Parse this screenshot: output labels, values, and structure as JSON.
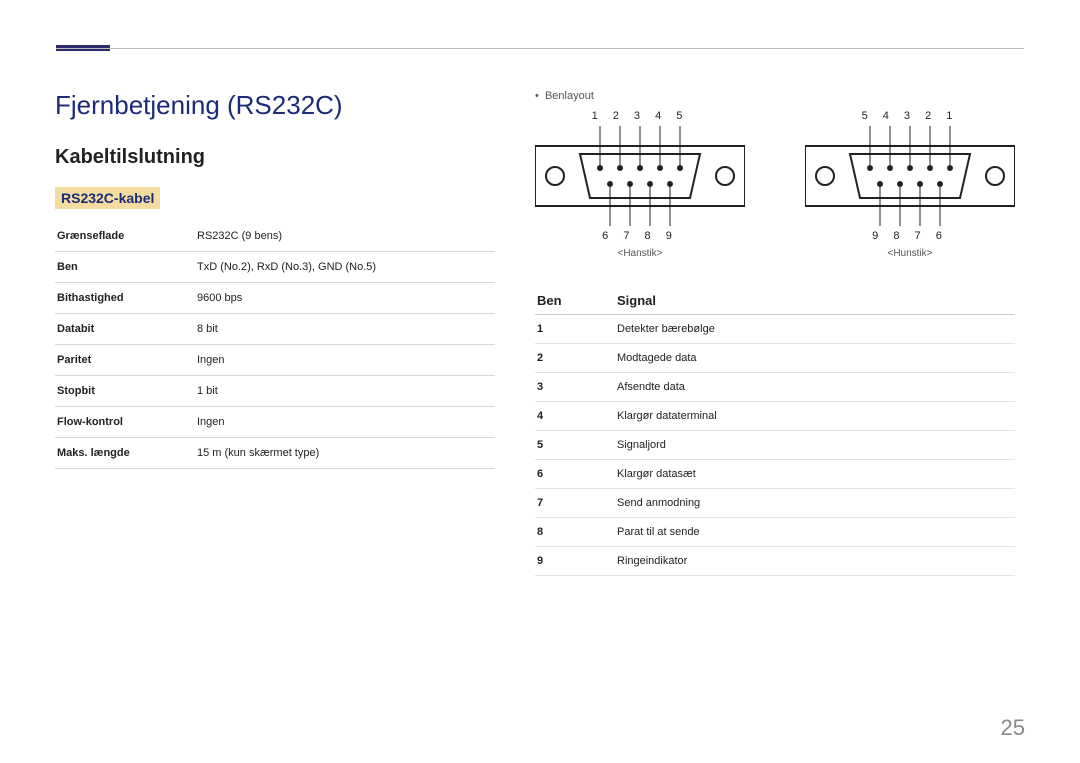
{
  "page": {
    "number": "25"
  },
  "headings": {
    "h1": "Fjernbetjening (RS232C)",
    "h2": "Kabeltilslutning",
    "h3": "RS232C-kabel"
  },
  "spec_table": [
    {
      "label": "Grænseflade",
      "value": "RS232C (9 bens)"
    },
    {
      "label": "Ben",
      "value": "TxD (No.2), RxD (No.3), GND (No.5)"
    },
    {
      "label": "Bithastighed",
      "value": "9600 bps"
    },
    {
      "label": "Databit",
      "value": "8 bit"
    },
    {
      "label": "Paritet",
      "value": "Ingen"
    },
    {
      "label": "Stopbit",
      "value": "1 bit"
    },
    {
      "label": "Flow-kontrol",
      "value": "Ingen"
    },
    {
      "label": "Maks. længde",
      "value": "15 m (kun skærmet type)"
    }
  ],
  "right": {
    "bullet": "Benlayout",
    "connectors": {
      "male": {
        "top_pins": "1 2 3 4 5",
        "bottom_pins": "6 7 8 9",
        "caption": "<Hanstik>"
      },
      "female": {
        "top_pins": "5 4 3 2 1",
        "bottom_pins": "9 8 7 6",
        "caption": "<Hunstik>"
      }
    },
    "signal_table": {
      "head_pin": "Ben",
      "head_signal": "Signal",
      "rows": [
        {
          "pin": "1",
          "signal": "Detekter bærebølge"
        },
        {
          "pin": "2",
          "signal": "Modtagede data"
        },
        {
          "pin": "3",
          "signal": "Afsendte data"
        },
        {
          "pin": "4",
          "signal": "Klargør dataterminal"
        },
        {
          "pin": "5",
          "signal": "Signaljord"
        },
        {
          "pin": "6",
          "signal": "Klargør datasæt"
        },
        {
          "pin": "7",
          "signal": "Send anmodning"
        },
        {
          "pin": "8",
          "signal": "Parat til at sende"
        },
        {
          "pin": "9",
          "signal": "Ringeindikator"
        }
      ]
    }
  }
}
